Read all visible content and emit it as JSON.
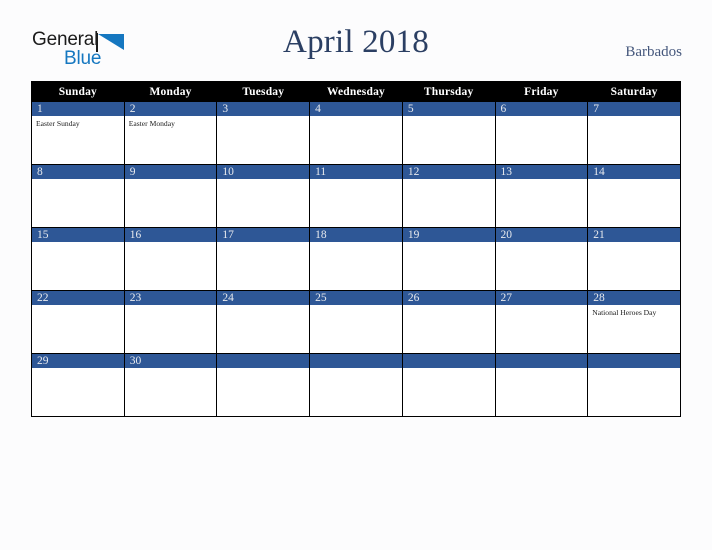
{
  "logo": {
    "word_one": "General",
    "word_two": "Blue",
    "triangle_icon": "triangle-icon",
    "colors": {
      "word_one": "#1b1b1b",
      "word_two": "#1577c0",
      "triangle": "#1577c0"
    }
  },
  "header": {
    "title": "April 2018",
    "country": "Barbados",
    "title_color": "#2b3f63",
    "country_color": "#45577c"
  },
  "calendar": {
    "weekday_headers": [
      "Sunday",
      "Monday",
      "Tuesday",
      "Wednesday",
      "Thursday",
      "Friday",
      "Saturday"
    ],
    "header_bg": "#000000",
    "header_text_color": "#ffffff",
    "daynum_bg": "#2e5796",
    "daynum_text_color": "#e8eaee",
    "cell_bg": "#ffffff",
    "border_color": "#000000",
    "weeks": [
      [
        {
          "day": "1",
          "events": [
            "Easter Sunday"
          ]
        },
        {
          "day": "2",
          "events": [
            "Easter Monday"
          ]
        },
        {
          "day": "3",
          "events": []
        },
        {
          "day": "4",
          "events": []
        },
        {
          "day": "5",
          "events": []
        },
        {
          "day": "6",
          "events": []
        },
        {
          "day": "7",
          "events": []
        }
      ],
      [
        {
          "day": "8",
          "events": []
        },
        {
          "day": "9",
          "events": []
        },
        {
          "day": "10",
          "events": []
        },
        {
          "day": "11",
          "events": []
        },
        {
          "day": "12",
          "events": []
        },
        {
          "day": "13",
          "events": []
        },
        {
          "day": "14",
          "events": []
        }
      ],
      [
        {
          "day": "15",
          "events": []
        },
        {
          "day": "16",
          "events": []
        },
        {
          "day": "17",
          "events": []
        },
        {
          "day": "18",
          "events": []
        },
        {
          "day": "19",
          "events": []
        },
        {
          "day": "20",
          "events": []
        },
        {
          "day": "21",
          "events": []
        }
      ],
      [
        {
          "day": "22",
          "events": []
        },
        {
          "day": "23",
          "events": []
        },
        {
          "day": "24",
          "events": []
        },
        {
          "day": "25",
          "events": []
        },
        {
          "day": "26",
          "events": []
        },
        {
          "day": "27",
          "events": []
        },
        {
          "day": "28",
          "events": [
            "National Heroes Day"
          ]
        }
      ],
      [
        {
          "day": "29",
          "events": []
        },
        {
          "day": "30",
          "events": []
        },
        {
          "day": "",
          "events": []
        },
        {
          "day": "",
          "events": []
        },
        {
          "day": "",
          "events": []
        },
        {
          "day": "",
          "events": []
        },
        {
          "day": "",
          "events": []
        }
      ]
    ]
  }
}
